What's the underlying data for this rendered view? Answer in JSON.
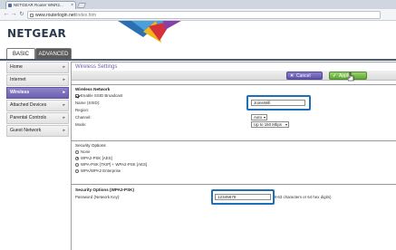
{
  "browser": {
    "tab_title": "NETGEAR Router WNR2...",
    "url_host": "www.routerlogin.net",
    "url_path": "/index.htm"
  },
  "header": {
    "logo": "NETGEAR"
  },
  "tabs": {
    "basic": "BASIC",
    "advanced": "ADVANCED"
  },
  "sidebar": {
    "items": [
      {
        "label": "Home",
        "active": false
      },
      {
        "label": "Internet",
        "active": false
      },
      {
        "label": "Wireless",
        "active": true
      },
      {
        "label": "Attached Devices",
        "active": false
      },
      {
        "label": "Parental Controls",
        "active": false
      },
      {
        "label": "Guest Network",
        "active": false
      }
    ]
  },
  "main": {
    "title": "Wireless Settings",
    "cancel_label": "Cancel",
    "apply_label": "Apply",
    "wireless_network": {
      "heading": "Wireless Network",
      "enable_broadcast_label": "Enable SSID Broadcast",
      "ssid_label": "Name (SSID):",
      "ssid_value": "JoinsWifi",
      "region_label": "Region:",
      "channel_label": "Channel:",
      "channel_value": "Auto",
      "mode_label": "Mode:",
      "mode_value": "Up to 150 Mbps"
    },
    "security_options": {
      "heading": "Security Options",
      "options": [
        {
          "label": "None",
          "selected": false
        },
        {
          "label": "WPA2-PSK [AES]",
          "selected": true
        },
        {
          "label": "WPA-PSK [TKIP] + WPA2-PSK [AES]",
          "selected": false
        },
        {
          "label": "WPA/WPA2 Enterprise",
          "selected": false
        }
      ]
    },
    "security_wpa2": {
      "heading": "Security Options (WPA2-PSK)",
      "password_label": "Password (Network Key):",
      "password_value": "12345678",
      "password_hint": "(8-63 characters or 64 hex digits)"
    }
  },
  "colors": {
    "accent_purple": "#6b5fb0",
    "apply_green": "#5ea836",
    "highlight_blue": "#1d6fb8"
  }
}
